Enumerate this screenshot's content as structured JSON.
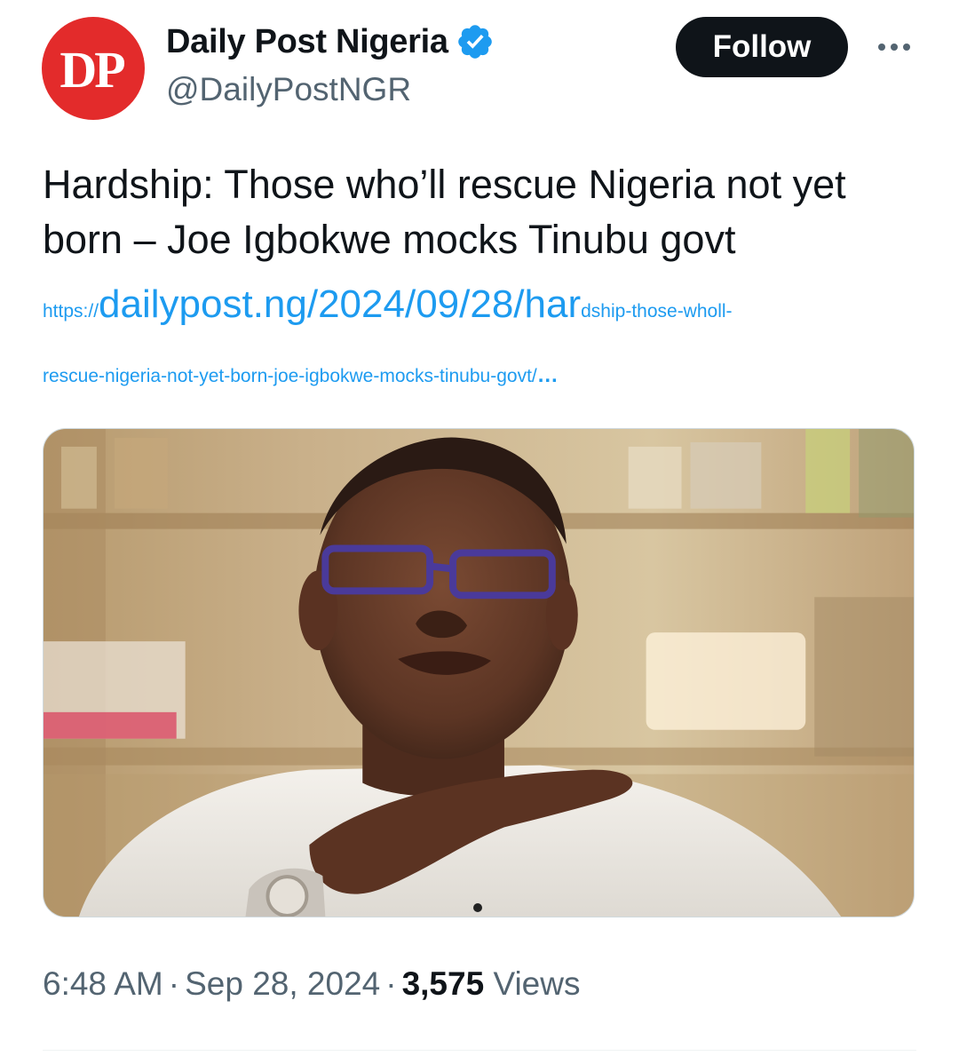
{
  "author": {
    "avatar_text": "DP",
    "display_name": "Daily Post Nigeria",
    "handle": "@DailyPostNGR",
    "verified_icon": "verified-badge-icon"
  },
  "actions": {
    "follow_label": "Follow",
    "more_icon": "more-horizontal-icon"
  },
  "tweet": {
    "text": "Hardship: Those who’ll rescue Nigeria not yet born – Joe Igbokwe mocks Tinubu govt",
    "link": {
      "prefix": "https://",
      "main": "dailypost.ng/2024/09/28/har",
      "tail": "dship-those-wholl-",
      "line2": "rescue-nigeria-not-yet-born-joe-igbokwe-mocks-tinubu-govt/",
      "ellipsis": "…"
    }
  },
  "footer": {
    "time": "6:48 AM",
    "separator": "·",
    "date": "Sep 28, 2024",
    "views_count": "3,575",
    "views_label": "Views"
  },
  "colors": {
    "link": "#1d9bf0",
    "avatar_bg": "#e32b2b",
    "follow_bg": "#0f1419",
    "muted_text": "#536471",
    "verified": "#1d9bf0"
  }
}
